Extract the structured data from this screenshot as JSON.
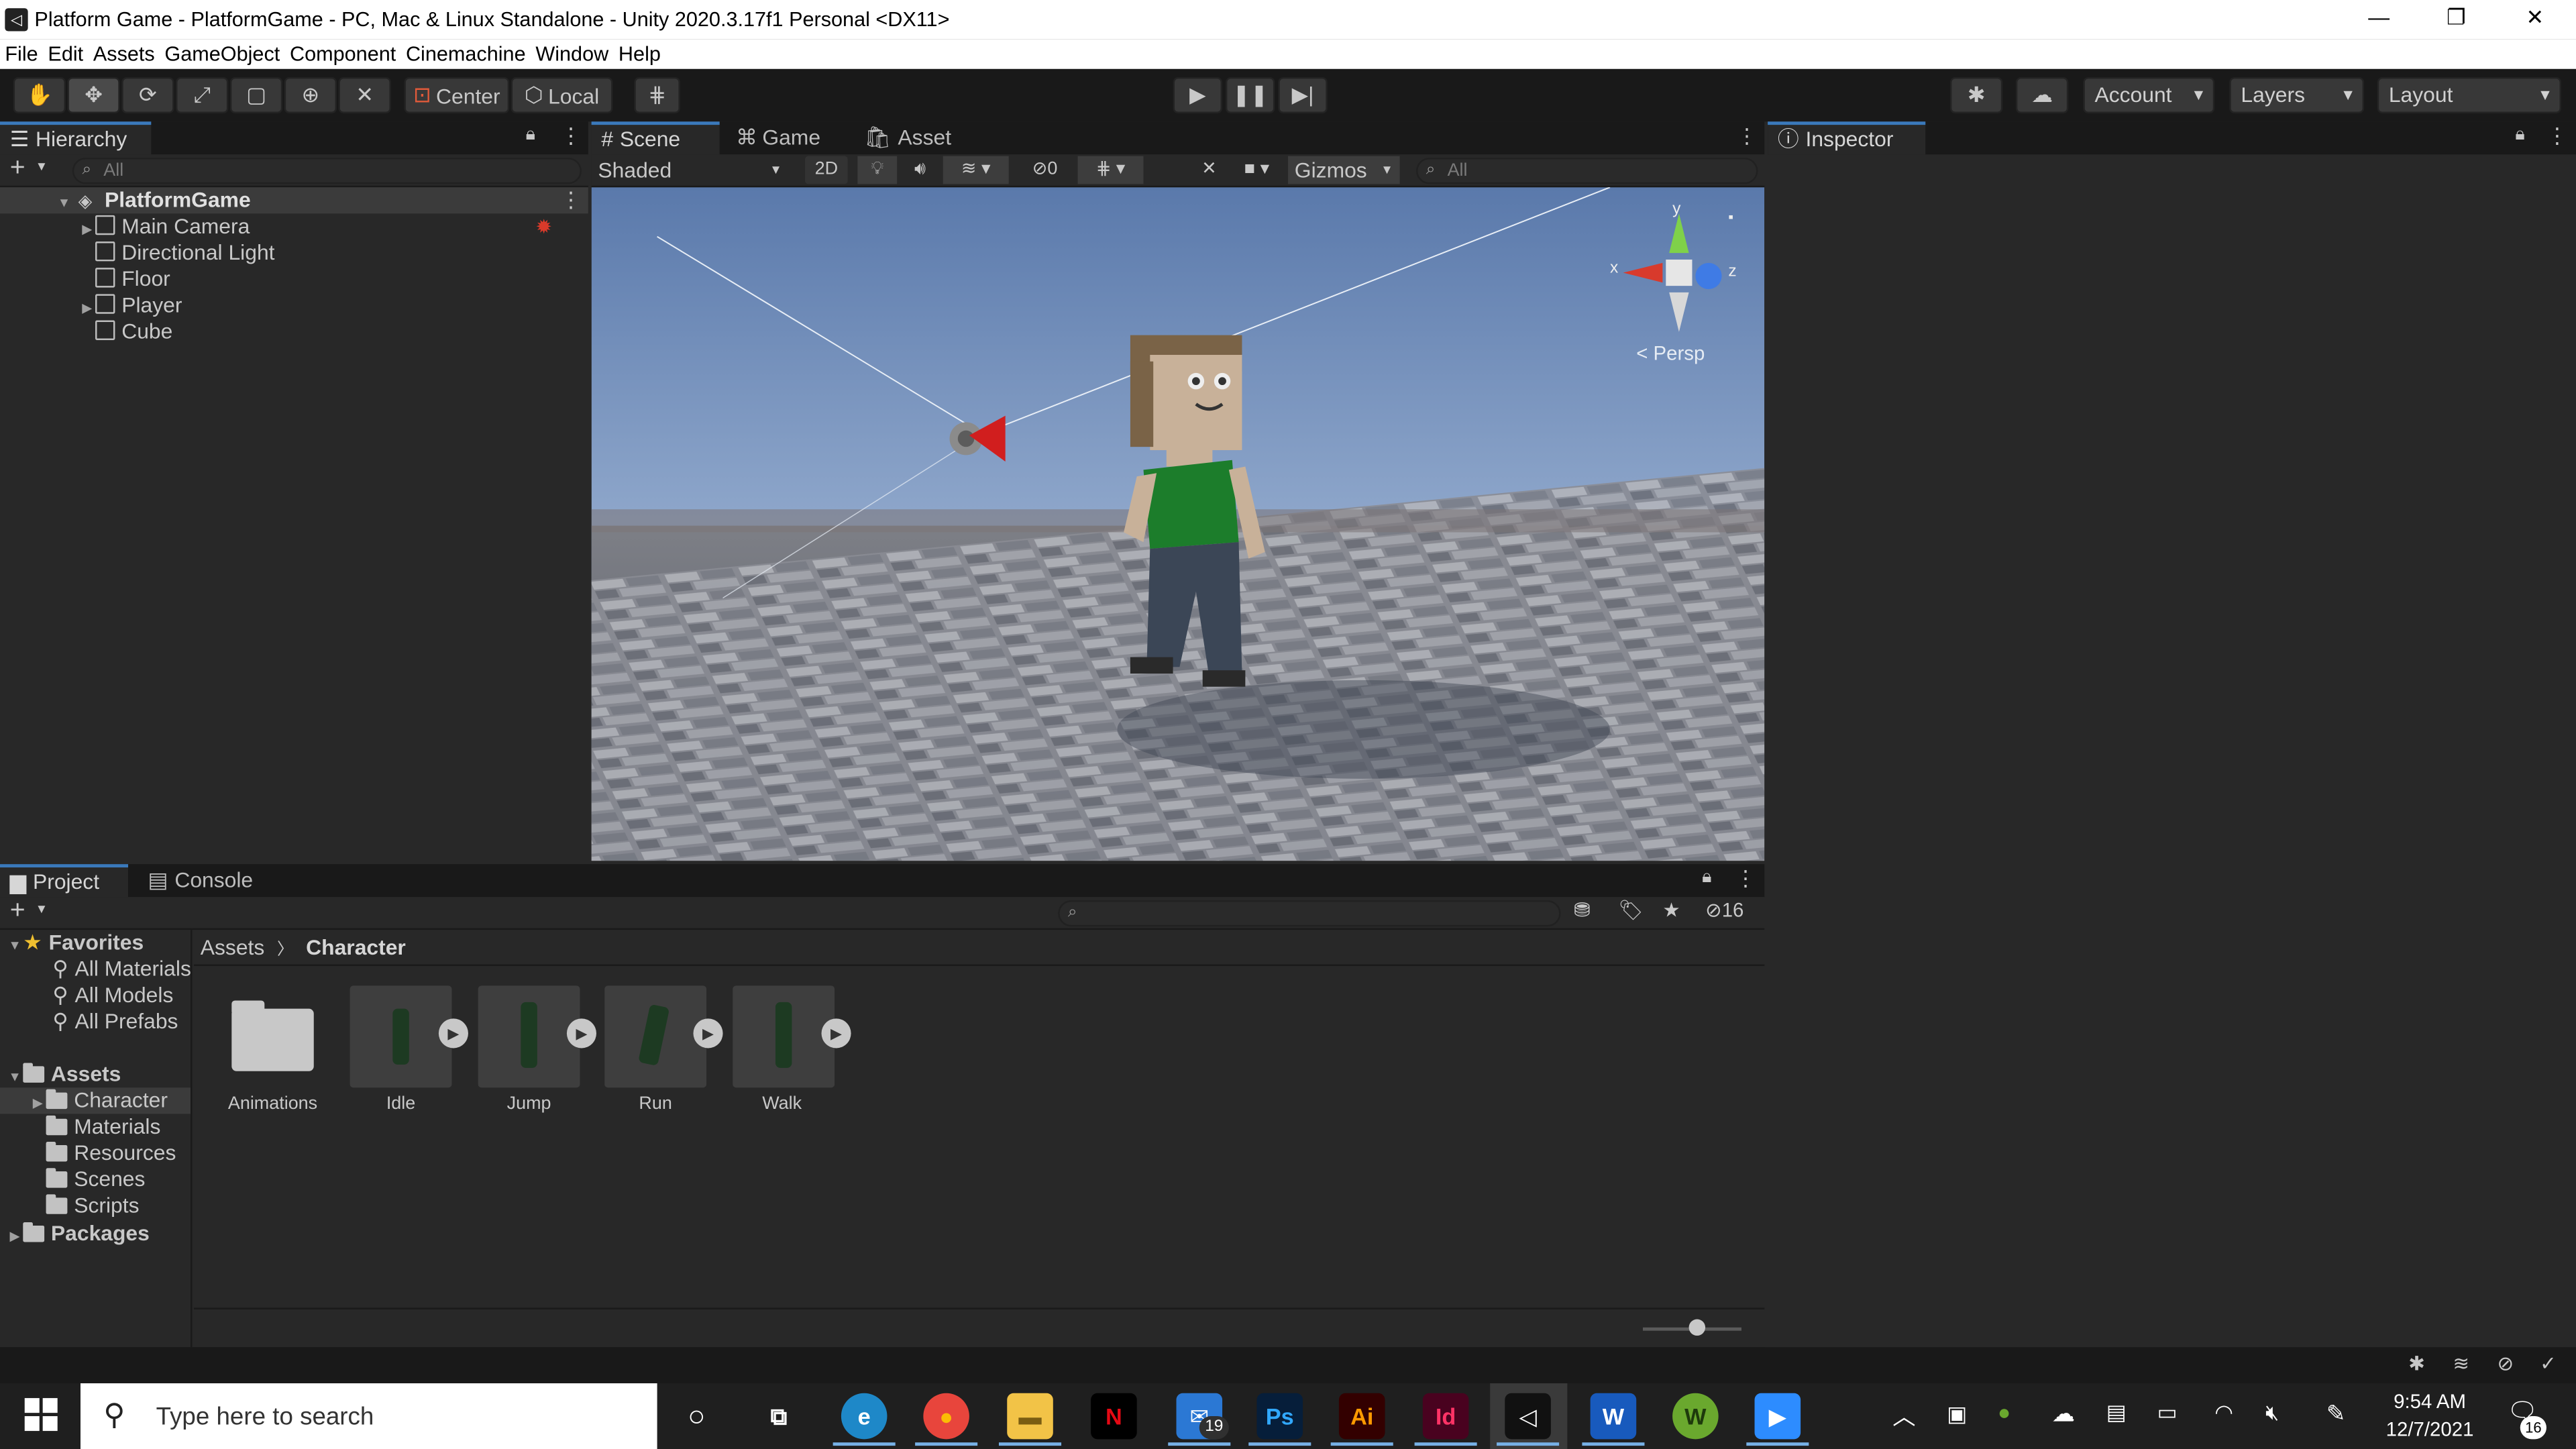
{
  "window": {
    "title": "Platform Game - PlatformGame - PC, Mac & Linux Standalone - Unity 2020.3.17f1 Personal <DX11>",
    "minimize": "—",
    "restore": "❐",
    "close": "✕"
  },
  "menu": [
    "File",
    "Edit",
    "Assets",
    "GameObject",
    "Component",
    "Cinemachine",
    "Window",
    "Help"
  ],
  "toolbar": {
    "pivot": "Center",
    "space": "Local",
    "account": "Account",
    "layers": "Layers",
    "layout": "Layout"
  },
  "hierarchy": {
    "tab": "Hierarchy",
    "search_placeholder": "All",
    "scene": "PlatformGame",
    "items": [
      "Main Camera",
      "Directional Light",
      "Floor",
      "Player",
      "Cube"
    ]
  },
  "scene_tabs": [
    "Scene",
    "Game",
    "Asset Store"
  ],
  "scene_toolbar": {
    "draw_mode": "Shaded",
    "mode_2d": "2D",
    "hidden_count": "0",
    "gizmos": "Gizmos",
    "search_placeholder": "All",
    "persp": "Persp",
    "axis_x": "x",
    "axis_y": "y",
    "axis_z": "z"
  },
  "inspector": {
    "tab": "Inspector"
  },
  "project": {
    "tabs": [
      "Project",
      "Console"
    ],
    "favorites_label": "Favorites",
    "favorites": [
      "All Materials",
      "All Models",
      "All Prefabs"
    ],
    "assets_label": "Assets",
    "asset_folders": [
      "Character",
      "Materials",
      "Resources",
      "Scenes",
      "Scripts"
    ],
    "packages_label": "Packages",
    "breadcrumb": [
      "Assets",
      "Character"
    ],
    "hidden_packages": "16",
    "grid_items": [
      "Animations",
      "Idle",
      "Jump",
      "Run",
      "Walk"
    ]
  },
  "taskbar": {
    "search_placeholder": "Type here to search",
    "time": "9:54 AM",
    "date": "12/7/2021",
    "mail_badge": "19",
    "notifications": "16"
  },
  "colors": {
    "accent": "#3a79bb",
    "panel_bg": "#282828",
    "toolbar_bg": "#191919"
  }
}
